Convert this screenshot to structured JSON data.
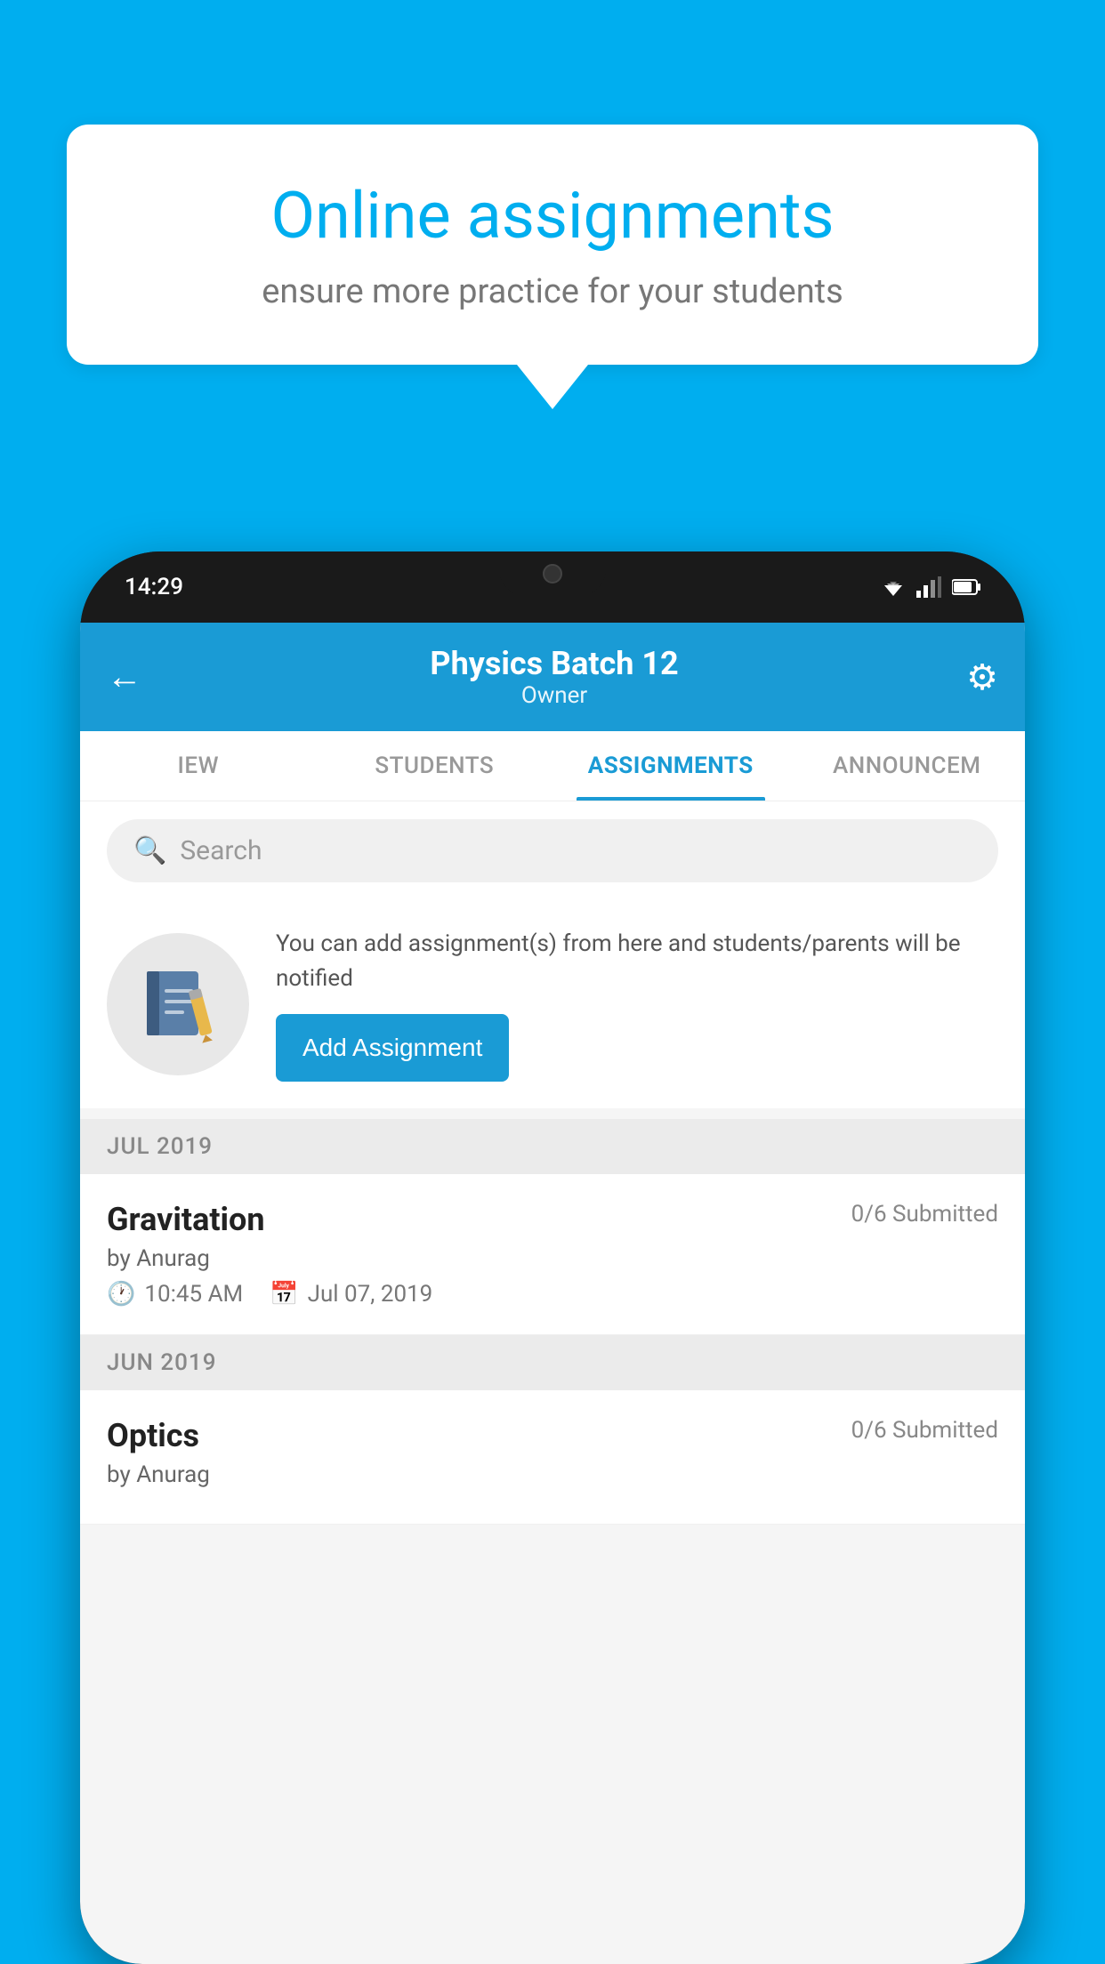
{
  "background_color": "#00AEEF",
  "speech_bubble": {
    "title": "Online assignments",
    "subtitle": "ensure more practice for your students"
  },
  "phone": {
    "status_bar": {
      "time": "14:29"
    },
    "header": {
      "title": "Physics Batch 12",
      "subtitle": "Owner",
      "back_label": "←",
      "gear_label": "⚙"
    },
    "tabs": [
      {
        "label": "IEW",
        "active": false
      },
      {
        "label": "STUDENTS",
        "active": false
      },
      {
        "label": "ASSIGNMENTS",
        "active": true
      },
      {
        "label": "ANNOUNCEM",
        "active": false
      }
    ],
    "search": {
      "placeholder": "Search"
    },
    "promo": {
      "description": "You can add assignment(s) from here and students/parents will be notified",
      "button_label": "Add Assignment"
    },
    "sections": [
      {
        "label": "JUL 2019",
        "assignments": [
          {
            "title": "Gravitation",
            "submitted": "0/6 Submitted",
            "author": "by Anurag",
            "time": "10:45 AM",
            "date": "Jul 07, 2019"
          }
        ]
      },
      {
        "label": "JUN 2019",
        "assignments": [
          {
            "title": "Optics",
            "submitted": "0/6 Submitted",
            "author": "by Anurag",
            "time": "",
            "date": ""
          }
        ]
      }
    ]
  }
}
